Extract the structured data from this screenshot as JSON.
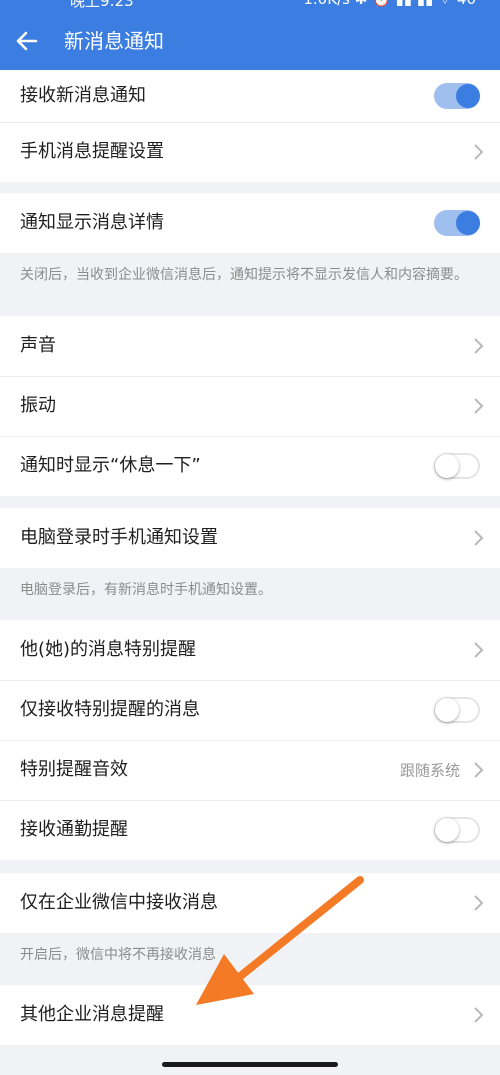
{
  "status_bar": {
    "left": "晚上9:23",
    "right": "1.0K/s ✱ ⏰ ▮▮ ▮▮ ⌔ 40"
  },
  "header": {
    "title": "新消息通知"
  },
  "colors": {
    "accent": "#3b7de0",
    "arrow": "#f47a25"
  },
  "sections": {
    "s1": {
      "receive_new": {
        "label": "接收新消息通知",
        "toggle": "on"
      },
      "phone_reminder": {
        "label": "手机消息提醒设置"
      }
    },
    "s2": {
      "show_details": {
        "label": "通知显示消息详情",
        "toggle": "on"
      },
      "hint": "关闭后，当收到企业微信消息后，通知提示将不显示发信人和内容摘要。"
    },
    "s3": {
      "sound": {
        "label": "声音"
      },
      "vibrate": {
        "label": "振动"
      },
      "rest_prompt": {
        "label": "通知时显示“休息一下”",
        "toggle": "off"
      }
    },
    "s4": {
      "pc_login": {
        "label": "电脑登录时手机通知设置"
      },
      "hint": "电脑登录后，有新消息时手机通知设置。"
    },
    "s5": {
      "special_remind": {
        "label": "他(她)的消息特别提醒"
      },
      "only_special": {
        "label": "仅接收特别提醒的消息",
        "toggle": "off"
      },
      "special_sound": {
        "label": "特别提醒音效",
        "value": "跟随系统"
      },
      "commute_remind": {
        "label": "接收通勤提醒",
        "toggle": "off"
      }
    },
    "s6": {
      "only_wecom": {
        "label": "仅在企业微信中接收消息"
      },
      "hint": "开启后，微信中将不再接收消息"
    },
    "s7": {
      "other_corp": {
        "label": "其他企业消息提醒"
      }
    }
  },
  "icons": {
    "back": "arrow-left-icon",
    "chevron": "chevron-right-icon",
    "annotation": "orange-arrow-annotation"
  }
}
